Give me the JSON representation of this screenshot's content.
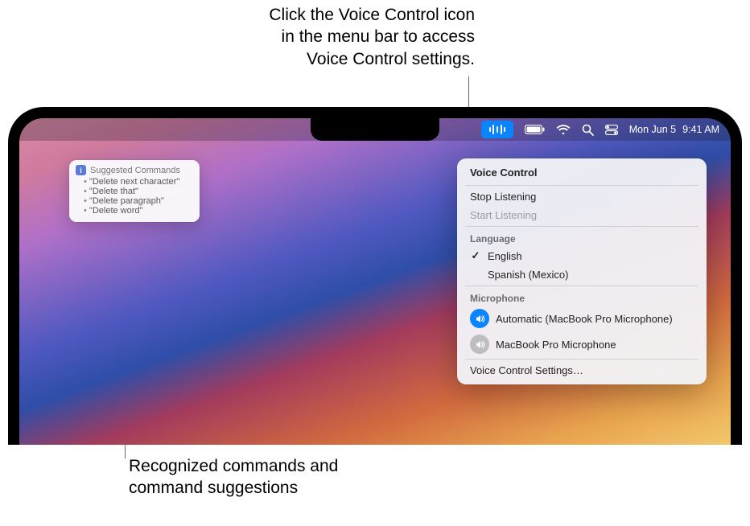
{
  "captions": {
    "top": "Click the Voice Control icon\nin the menu bar to access\nVoice Control settings.",
    "bottom": "Recognized commands and\ncommand suggestions"
  },
  "menubar": {
    "date": "Mon Jun 5",
    "time": "9:41 AM"
  },
  "suggestedCommands": {
    "title": "Suggested Commands",
    "items": [
      "\"Delete next character\"",
      "\"Delete that\"",
      "\"Delete paragraph\"",
      "\"Delete word\""
    ]
  },
  "dropdown": {
    "title": "Voice Control",
    "stop": "Stop Listening",
    "start": "Start Listening",
    "languageLabel": "Language",
    "languages": [
      {
        "name": "English",
        "selected": true
      },
      {
        "name": "Spanish (Mexico)",
        "selected": false
      }
    ],
    "microphoneLabel": "Microphone",
    "microphones": [
      {
        "name": "Automatic (MacBook Pro Microphone)",
        "active": true
      },
      {
        "name": "MacBook Pro Microphone",
        "active": false
      }
    ],
    "settings": "Voice Control Settings…"
  }
}
